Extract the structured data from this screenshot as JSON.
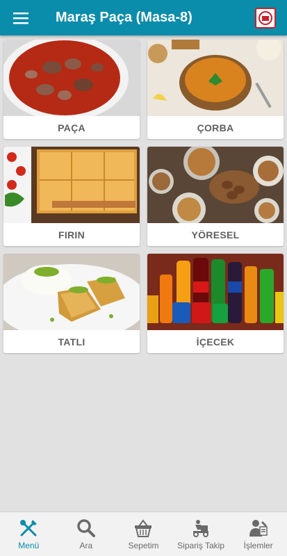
{
  "app": {
    "title": "Maraş Paça (Masa-8)",
    "accent_color": "#0a8cab",
    "menu_icon": "hamburger-icon",
    "logo": "restaurant-logo"
  },
  "categories": [
    {
      "label": "PAÇA",
      "image": "paca-soup-photo"
    },
    {
      "label": "ÇORBA",
      "image": "lentil-soup-photo"
    },
    {
      "label": "FIRIN",
      "image": "oven-pide-photo"
    },
    {
      "label": "YÖRESEL",
      "image": "regional-dishes-photo"
    },
    {
      "label": "TATLI",
      "image": "baklava-dessert-photo"
    },
    {
      "label": "İÇECEK",
      "image": "soft-drinks-photo"
    }
  ],
  "bottom_nav": [
    {
      "label": "Menü",
      "icon": "fork-knife-icon",
      "active": true
    },
    {
      "label": "Ara",
      "icon": "search-icon",
      "active": false
    },
    {
      "label": "Sepetim",
      "icon": "basket-icon",
      "active": false
    },
    {
      "label": "Sipariş Takip",
      "icon": "delivery-icon",
      "active": false
    },
    {
      "label": "İşlemler",
      "icon": "user-settings-icon",
      "active": false
    }
  ]
}
